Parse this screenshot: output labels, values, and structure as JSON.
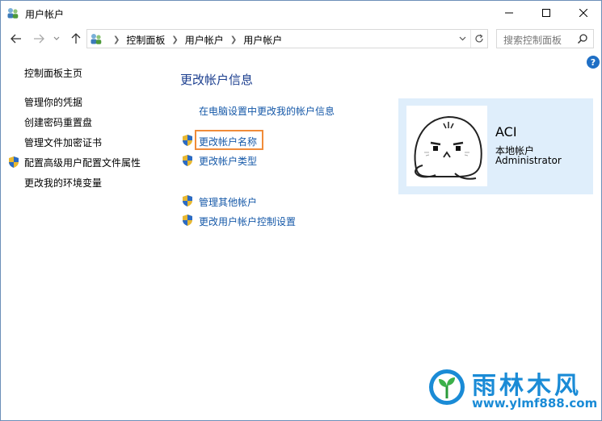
{
  "window": {
    "title": "用户帐户",
    "controls": {
      "minimize": "minimize-icon",
      "maximize": "maximize-icon",
      "close": "close-icon"
    }
  },
  "address_bar": {
    "breadcrumbs": [
      "控制面板",
      "用户帐户",
      "用户帐户"
    ],
    "search_placeholder": "搜索控制面板"
  },
  "help_glyph": "?",
  "sidebar": {
    "items": [
      {
        "label": "控制面板主页",
        "shield": false
      },
      {
        "label": "管理你的凭据",
        "shield": false
      },
      {
        "label": "创建密码重置盘",
        "shield": false
      },
      {
        "label": "管理文件加密证书",
        "shield": false
      },
      {
        "label": "配置高级用户配置文件属性",
        "shield": true
      },
      {
        "label": "更改我的环境变量",
        "shield": false
      }
    ]
  },
  "main": {
    "heading": "更改帐户信息",
    "pc_settings_link": "在电脑设置中更改我的帐户信息",
    "links": [
      {
        "label": "更改帐户名称",
        "highlighted": true
      },
      {
        "label": "更改帐户类型"
      },
      {
        "label": "管理其他帐户"
      },
      {
        "label": "更改用户帐户控制设置"
      }
    ]
  },
  "account": {
    "name": "ACI",
    "type": "本地帐户",
    "role": "Administrator"
  },
  "watermark": {
    "title": "雨林木风",
    "url": "www.ylmf888.com"
  },
  "colors": {
    "link_blue": "#1558a8",
    "heading_blue": "#1c3f8f",
    "card_bg": "#dfeefb",
    "highlight_orange": "#f08c3a",
    "watermark_blue": "#1a8bd6"
  }
}
